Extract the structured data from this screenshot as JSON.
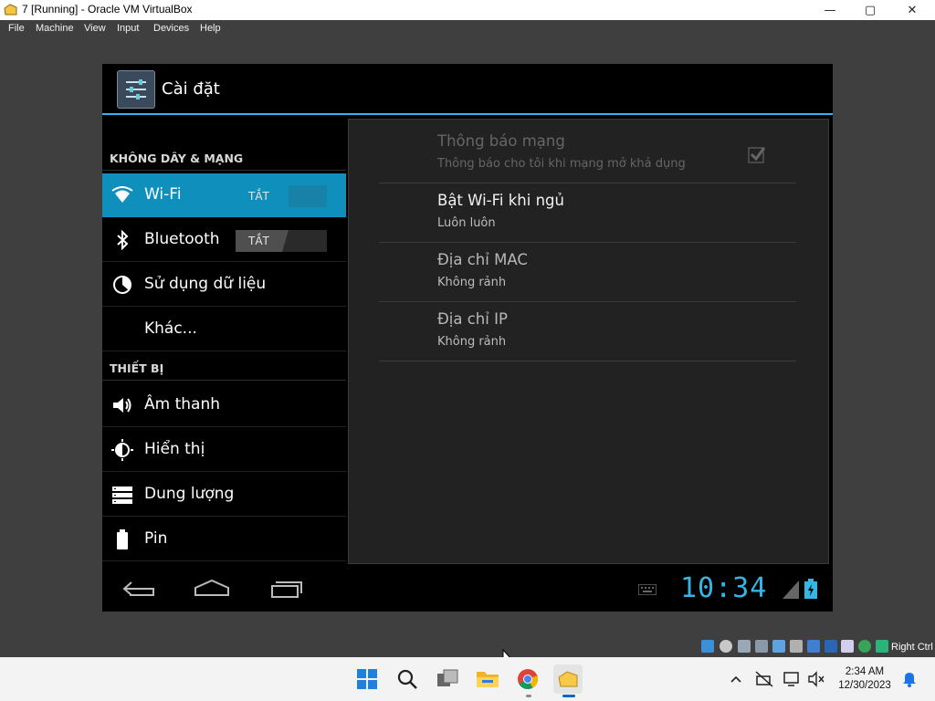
{
  "window": {
    "title": "7 [Running] - Oracle VM VirtualBox",
    "min_glyph": "—",
    "max_glyph": "▢",
    "close_glyph": "✕",
    "menu": [
      "File",
      "Machine",
      "View",
      "Input",
      "Devices",
      "Help"
    ]
  },
  "android": {
    "app_title": "Cài đặt",
    "sections": {
      "wireless": "KHÔNG DÂY & MẠNG",
      "device": "THIẾT BỊ"
    },
    "items": {
      "wifi": {
        "label": "Wi-Fi",
        "toggle": "TẮT",
        "icon": "wifi-icon",
        "selected": true
      },
      "bluetooth": {
        "label": "Bluetooth",
        "toggle": "TẮT",
        "icon": "bluetooth-icon"
      },
      "data": {
        "label": "Sử dụng dữ liệu",
        "icon": "data-usage-icon"
      },
      "more": {
        "label": "Khác..."
      },
      "sound": {
        "label": "Âm thanh",
        "icon": "speaker-icon"
      },
      "display": {
        "label": "Hiển thị",
        "icon": "brightness-icon"
      },
      "storage": {
        "label": "Dung lượng",
        "icon": "storage-icon"
      },
      "battery": {
        "label": "Pin",
        "icon": "battery-icon"
      }
    },
    "prefs": {
      "network_notify": {
        "title": "Thông báo mạng",
        "summary": "Thông báo cho tôi khi mạng mở khả dụng",
        "checked": true,
        "enabled": false
      },
      "wifi_sleep": {
        "title": "Bật Wi-Fi khi ngủ",
        "summary": "Luôn luôn"
      },
      "mac": {
        "title": "Địa chỉ MAC",
        "summary": "Không rảnh"
      },
      "ip": {
        "title": "Địa chỉ IP",
        "summary": "Không rảnh"
      }
    },
    "clock": "10:34",
    "accent": "#33b5e5"
  },
  "vbox_tray": {
    "host_key": "Right Ctrl"
  },
  "taskbar": {
    "time": "2:34 AM",
    "date": "12/30/2023"
  }
}
